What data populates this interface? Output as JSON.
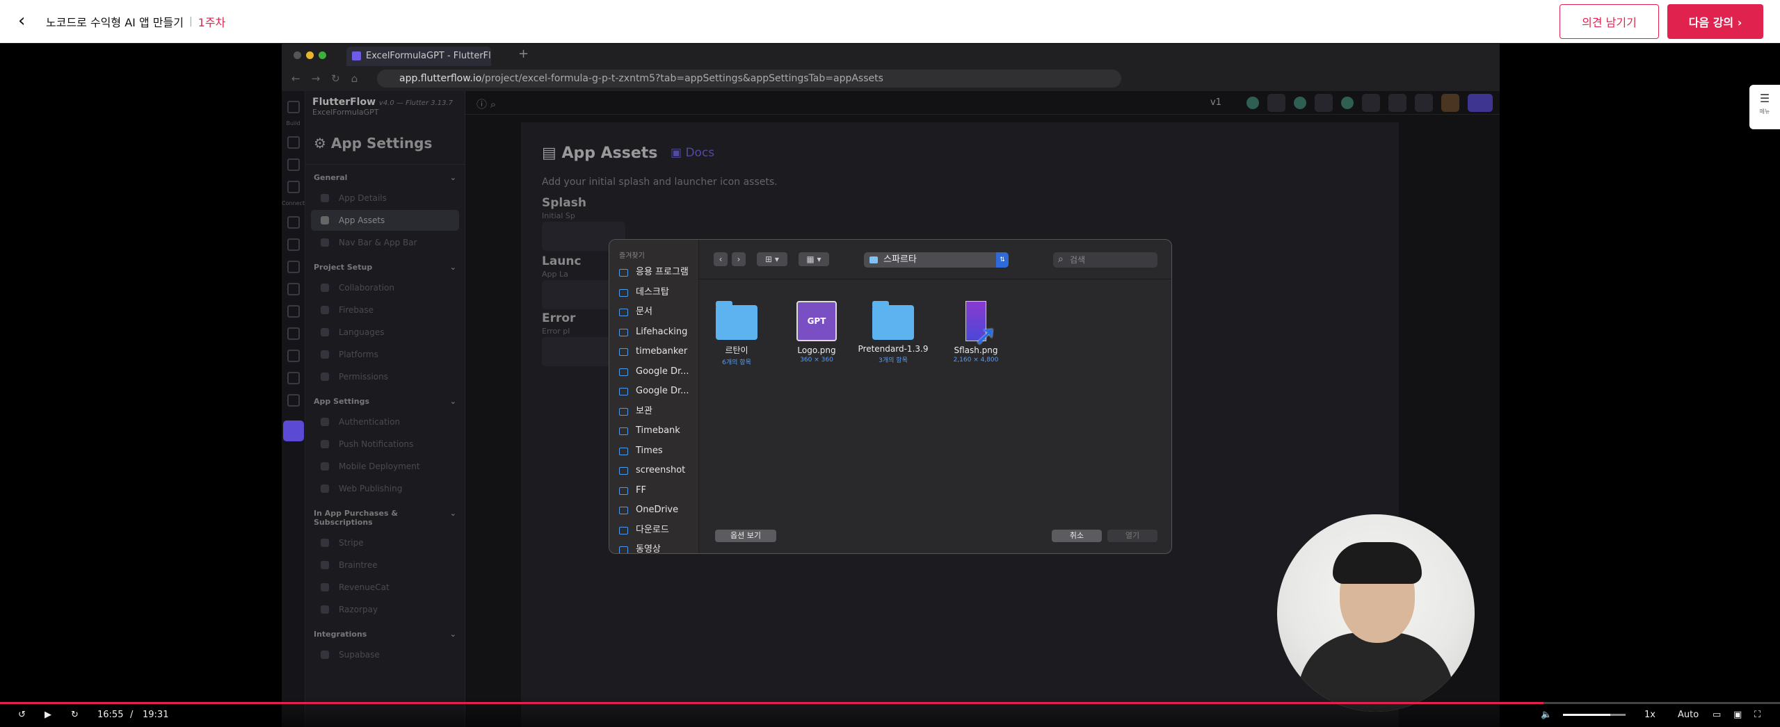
{
  "header": {
    "course_title": "노코드로 수익형 AI 앱 만들기",
    "week": "1주차",
    "feedback_button": "의견 남기기",
    "next_button": "다음 강의 ›"
  },
  "browser": {
    "tab_title": "ExcelFormulaGPT - FlutterFlo",
    "url_host": "app.flutterflow.io",
    "url_path": "/project/excel-formula-g-p-t-zxntm5?tab=appSettings&appSettingsTab=appAssets"
  },
  "flutterflow": {
    "brand": "FlutterFlow",
    "version": "v4.0 — Flutter 3.13.7",
    "project": "ExcelFormulaGPT",
    "rail_labels": [
      "Build",
      "Connect"
    ],
    "sidebar_title": "App Settings",
    "sections": [
      {
        "title": "General",
        "items": [
          {
            "label": "App Details",
            "selected": false
          },
          {
            "label": "App Assets",
            "selected": true
          },
          {
            "label": "Nav Bar & App Bar",
            "selected": false
          }
        ]
      },
      {
        "title": "Project Setup",
        "items": [
          {
            "label": "Collaboration"
          },
          {
            "label": "Firebase"
          },
          {
            "label": "Languages"
          },
          {
            "label": "Platforms"
          },
          {
            "label": "Permissions"
          }
        ]
      },
      {
        "title": "App Settings",
        "items": [
          {
            "label": "Authentication"
          },
          {
            "label": "Push Notifications"
          },
          {
            "label": "Mobile Deployment"
          },
          {
            "label": "Web Publishing"
          }
        ]
      },
      {
        "title": "In App Purchases & Subscriptions",
        "items": [
          {
            "label": "Stripe"
          },
          {
            "label": "Braintree"
          },
          {
            "label": "RevenueCat"
          },
          {
            "label": "Razorpay"
          }
        ]
      },
      {
        "title": "Integrations",
        "items": [
          {
            "label": "Supabase"
          }
        ]
      }
    ],
    "version_select": "v1",
    "page_title": "App Assets",
    "docs_link": "Docs",
    "page_subtitle": "Add your initial splash and launcher icon assets.",
    "splash_label": "Splash",
    "splash_sub": "Initial Sp",
    "launcher_label": "Launc",
    "launcher_sub": "App La",
    "error_label": "Error",
    "error_sub": "Error pl"
  },
  "dialog": {
    "favorites_header": "즐겨찾기",
    "favorites": [
      "응용 프로그램",
      "데스크탑",
      "문서",
      "Lifehacking",
      "timebanker",
      "Google Dr...",
      "Google Dr...",
      "보관",
      "Timebank",
      "Times",
      "screenshot",
      "FF",
      "OneDrive",
      "다운로드",
      "동영상"
    ],
    "location": "스파르타",
    "search_placeholder": "검색",
    "files": [
      {
        "name": "르탄이",
        "meta": "6개의 항목",
        "kind": "folder"
      },
      {
        "name": "Logo.png",
        "meta": "360 × 360",
        "kind": "logo",
        "icon_text": "GPT"
      },
      {
        "name": "Pretendard-1.3.9",
        "meta": "3개의 항목",
        "kind": "folder"
      },
      {
        "name": "Sflash.png",
        "meta": "2,160 × 4,800",
        "kind": "splash"
      }
    ],
    "options_button": "옵션 보기",
    "cancel_button": "취소",
    "open_button": "열기"
  },
  "floating_menu": {
    "label": "메뉴"
  },
  "player": {
    "current_time": "16:55",
    "separator": "/",
    "duration": "19:31",
    "progress": 0.867,
    "volume": 0.75,
    "speed": "1x",
    "quality": "Auto"
  },
  "colors": {
    "accent": "#e0234e",
    "ff_purple": "#5b4bd4"
  }
}
